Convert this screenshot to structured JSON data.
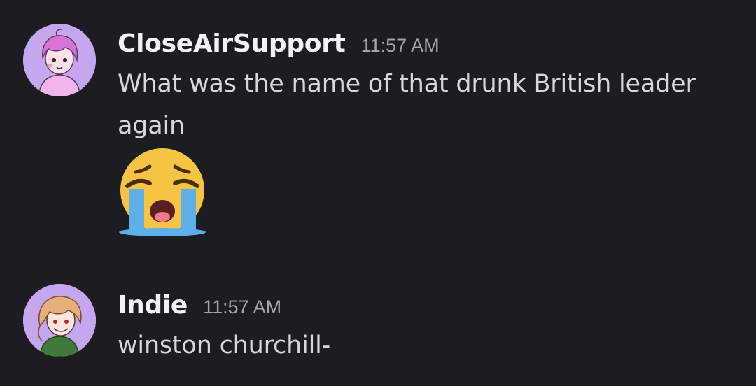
{
  "messages": [
    {
      "username": "CloseAirSupport",
      "timestamp": "11:57 AM",
      "text": "What was the name of that drunk British leader again",
      "emoji": "loudly-crying-face-emoji"
    },
    {
      "username": "Indie",
      "timestamp": "11:57 AM",
      "text": "winston churchill-"
    }
  ],
  "colors": {
    "background": "#1c1c21",
    "username": "#f2f3f5",
    "timestamp": "#a2a5ad",
    "message_text": "#d6d8dc",
    "avatar_background": "#c5a7f0"
  }
}
